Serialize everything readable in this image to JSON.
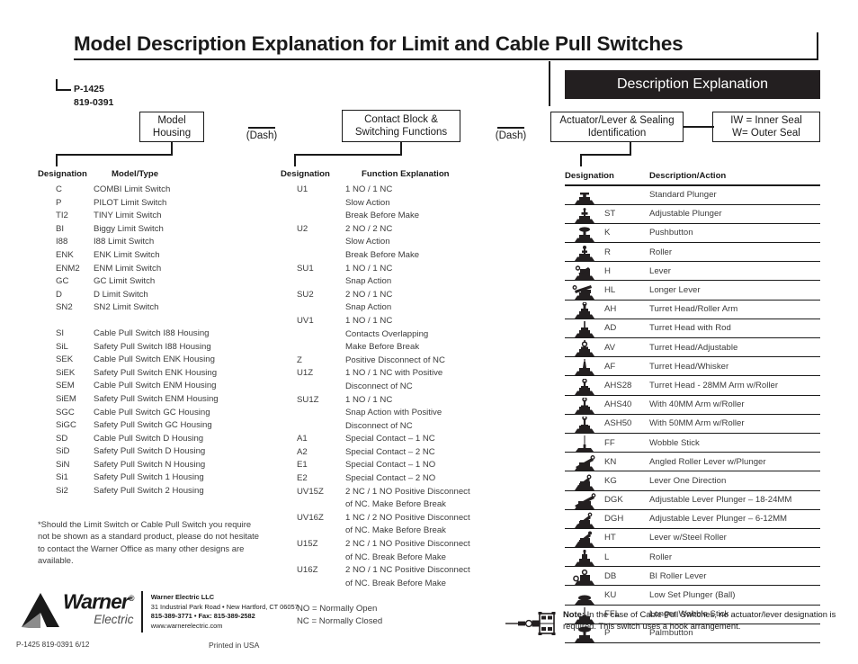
{
  "document": {
    "title": "Model Description Explanation for Limit and Cable Pull Switches",
    "banner": "Description Explanation",
    "part_number_1": "P-1425",
    "part_number_2": "819-0391"
  },
  "flow": {
    "box_model_housing": "Model\nHousing",
    "box_model_housing_line1": "Model",
    "box_model_housing_line2": "Housing",
    "dash_1": "(Dash)",
    "box_contact_block_line1": "Contact Block &",
    "box_contact_block_line2": "Switching Functions",
    "dash_2": "(Dash)",
    "box_actuator_line1": "Actuator/Lever & Sealing",
    "box_actuator_line2": "Identification",
    "box_seal_line1": "IW = Inner Seal",
    "box_seal_line2": "W= Outer Seal"
  },
  "model_housing_table": {
    "header_designation": "Designation",
    "header_type": "Model/Type",
    "rows": [
      {
        "designation": "C",
        "type": "COMBI Limit Switch"
      },
      {
        "designation": "P",
        "type": "PILOT Limit Switch"
      },
      {
        "designation": "TI2",
        "type": "TINY Limit Switch"
      },
      {
        "designation": "BI",
        "type": "Biggy Limit Switch"
      },
      {
        "designation": "I88",
        "type": "I88 Limit Switch"
      },
      {
        "designation": "ENK",
        "type": "ENK Limit Switch"
      },
      {
        "designation": "ENM2",
        "type": "ENM Limit Switch"
      },
      {
        "designation": "GC",
        "type": "GC Limit Switch"
      },
      {
        "designation": "D",
        "type": "D Limit Switch"
      },
      {
        "designation": "SN2",
        "type": "SN2 Limit Switch"
      }
    ],
    "rows2": [
      {
        "designation": "SI",
        "type": "Cable Pull Switch I88 Housing"
      },
      {
        "designation": "SiL",
        "type": "Safety Pull Switch I88 Housing"
      },
      {
        "designation": "SEK",
        "type": "Cable Pull Switch ENK Housing"
      },
      {
        "designation": "SiEK",
        "type": "Safety Pull Switch ENK Housing"
      },
      {
        "designation": "SEM",
        "type": "Cable Pull Switch ENM Housing"
      },
      {
        "designation": "SiEM",
        "type": "Safety Pull Switch ENM Housing"
      },
      {
        "designation": "SGC",
        "type": "Cable Pull Switch GC Housing"
      },
      {
        "designation": "SiGC",
        "type": "Safety Pull Switch GC Housing"
      },
      {
        "designation": "SD",
        "type": "Cable Pull Switch D Housing"
      },
      {
        "designation": "SiD",
        "type": "Safety Pull Switch D Housing"
      },
      {
        "designation": "SiN",
        "type": "Safety Pull Switch N Housing"
      },
      {
        "designation": "Si1",
        "type": "Safety Pull Switch 1 Housing"
      },
      {
        "designation": "Si2",
        "type": "Safety Pull Switch 2 Housing"
      }
    ],
    "footnote": "*Should the Limit Switch or Cable Pull Switch you require not be shown as a standard product, please do not hesitate to contact the Warner Office as many other designs are available."
  },
  "contact_block_table": {
    "header_designation": "Designation",
    "header_function": "Function Explanation",
    "rows": [
      {
        "designation": "U1",
        "function": "1 NO / 1 NC"
      },
      {
        "designation": "",
        "function": "Slow Action"
      },
      {
        "designation": "",
        "function": "Break Before Make"
      },
      {
        "designation": "U2",
        "function": "2 NO / 2 NC"
      },
      {
        "designation": "",
        "function": "Slow Action"
      },
      {
        "designation": "",
        "function": "Break Before Make"
      },
      {
        "designation": "SU1",
        "function": "1 NO / 1 NC"
      },
      {
        "designation": "",
        "function": "Snap Action"
      },
      {
        "designation": "SU2",
        "function": "2 NO / 1 NC"
      },
      {
        "designation": "",
        "function": "Snap Action"
      },
      {
        "designation": "UV1",
        "function": "1 NO / 1 NC"
      },
      {
        "designation": "",
        "function": "Contacts Overlapping"
      },
      {
        "designation": "",
        "function": "Make Before Break"
      },
      {
        "designation": "Z",
        "function": "Positive Disconnect of NC"
      },
      {
        "designation": "U1Z",
        "function": "1 NO / 1 NC with Positive"
      },
      {
        "designation": "",
        "function": "Disconnect of NC"
      },
      {
        "designation": "SU1Z",
        "function": "1 NO / 1 NC"
      },
      {
        "designation": "",
        "function": "Snap Action with Positive"
      },
      {
        "designation": "",
        "function": "Disconnect of NC"
      },
      {
        "designation": "A1",
        "function": "Special Contact – 1 NC"
      },
      {
        "designation": "A2",
        "function": "Special Contact – 2 NC"
      },
      {
        "designation": "E1",
        "function": "Special Contact – 1 NO"
      },
      {
        "designation": "E2",
        "function": "Special Contact – 2 NO"
      },
      {
        "designation": "UV15Z",
        "function": "2 NC / 1 NO Positive Disconnect"
      },
      {
        "designation": "",
        "function": "of NC. Make Before Break"
      },
      {
        "designation": "UV16Z",
        "function": "1 NC / 2 NO Positive Disconnect"
      },
      {
        "designation": "",
        "function": "of NC. Make Before Break"
      },
      {
        "designation": "U15Z",
        "function": "2 NC / 1 NO Positive Disconnect"
      },
      {
        "designation": "",
        "function": "of NC. Break Before Make"
      },
      {
        "designation": "U16Z",
        "function": "2 NO / 1 NC Positive Disconnect"
      },
      {
        "designation": "",
        "function": "of NC. Break Before Make"
      }
    ],
    "legend_no": "NO = Normally Open",
    "legend_nc": "NC = Normally Closed"
  },
  "actuator_table": {
    "header_designation": "Designation",
    "header_description": "Description/Action",
    "rows": [
      {
        "icon": "standard-plunger-icon",
        "designation": "",
        "description": "Standard Plunger"
      },
      {
        "icon": "adjustable-plunger-icon",
        "designation": "ST",
        "description": "Adjustable Plunger"
      },
      {
        "icon": "pushbutton-icon",
        "designation": "K",
        "description": "Pushbutton"
      },
      {
        "icon": "roller-icon",
        "designation": "R",
        "description": "Roller"
      },
      {
        "icon": "lever-icon",
        "designation": "H",
        "description": "Lever"
      },
      {
        "icon": "longer-lever-icon",
        "designation": "HL",
        "description": "Longer Lever"
      },
      {
        "icon": "turret-head-roller-arm-icon",
        "designation": "AH",
        "description": "Turret Head/Roller Arm"
      },
      {
        "icon": "turret-head-rod-icon",
        "designation": "AD",
        "description": "Turret Head with Rod"
      },
      {
        "icon": "turret-head-adjustable-icon",
        "designation": "AV",
        "description": "Turret Head/Adjustable"
      },
      {
        "icon": "turret-head-whisker-icon",
        "designation": "AF",
        "description": "Turret Head/Whisker"
      },
      {
        "icon": "turret-head-28mm-icon",
        "designation": "AHS28",
        "description": "Turret Head - 28MM Arm w/Roller"
      },
      {
        "icon": "turret-head-40mm-icon",
        "designation": "AHS40",
        "description": "With 40MM Arm w/Roller"
      },
      {
        "icon": "turret-head-50mm-icon",
        "designation": "ASH50",
        "description": "With 50MM Arm w/Roller"
      },
      {
        "icon": "wobble-stick-icon",
        "designation": "FF",
        "description": "Wobble Stick"
      },
      {
        "icon": "angled-roller-lever-icon",
        "designation": "KN",
        "description": "Angled Roller Lever w/Plunger"
      },
      {
        "icon": "lever-one-direction-icon",
        "designation": "KG",
        "description": "Lever One Direction"
      },
      {
        "icon": "adjustable-lever-plunger-18-24-icon",
        "designation": "DGK",
        "description": "Adjustable Lever Plunger – 18-24MM"
      },
      {
        "icon": "adjustable-lever-plunger-6-12-icon",
        "designation": "DGH",
        "description": "Adjustable Lever Plunger – 6-12MM"
      },
      {
        "icon": "lever-steel-roller-icon",
        "designation": "HT",
        "description": "Lever w/Steel Roller"
      },
      {
        "icon": "roller-l-icon",
        "designation": "L",
        "description": "Roller"
      },
      {
        "icon": "bi-roller-lever-icon",
        "designation": "DB",
        "description": "BI Roller Lever"
      },
      {
        "icon": "low-set-plunger-ball-icon",
        "designation": "KU",
        "description": "Low Set Plunger (Ball)"
      },
      {
        "icon": "longer-wobble-stick-icon",
        "designation": "FFL",
        "description": "Longer Wobble Stick"
      },
      {
        "icon": "palmbutton-icon",
        "designation": "P",
        "description": "Palmbutton"
      }
    ]
  },
  "note": {
    "icon": "hook-arrangement-icon",
    "label": "Note:",
    "text": " In the case of Cable Pull Switches, no actuator/lever designation is required. This switch uses a hook arrangement."
  },
  "logo": {
    "brand": "Warner",
    "registered": "®",
    "sub": "Electric",
    "company": "Warner Electric LLC",
    "address": "31 Industrial Park Road • New Hartford, CT 06057",
    "phone": "815-389-3771 • Fax: 815-389-2582",
    "website": "www.warnerelectric.com"
  },
  "footer": {
    "left": "P-1425   819-0391  6/12",
    "center": "Printed in USA"
  },
  "colors": {
    "ink": "#231f20",
    "text": "#3b3b3b",
    "banner_bg": "#231f20",
    "banner_fg": "#ffffff"
  }
}
